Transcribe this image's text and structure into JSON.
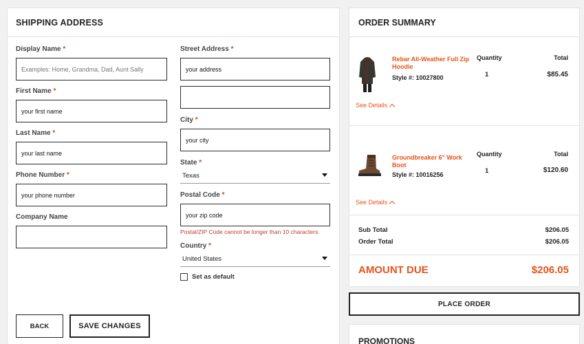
{
  "shipping": {
    "title": "SHIPPING ADDRESS",
    "required_mark": "*",
    "display_name": {
      "label": "Display Name",
      "value": "",
      "placeholder": "Examples: Home, Grandma, Dad, Aunt Sally"
    },
    "first_name": {
      "label": "First Name",
      "value": "your first name"
    },
    "last_name": {
      "label": "Last Name",
      "value": "your last name"
    },
    "phone": {
      "label": "Phone Number",
      "value": "your phone number"
    },
    "company": {
      "label": "Company Name",
      "value": ""
    },
    "street": {
      "label": "Street Address",
      "value": "your address"
    },
    "street2": {
      "value": ""
    },
    "city": {
      "label": "City",
      "value": "your city"
    },
    "state": {
      "label": "State",
      "value": "Texas"
    },
    "postal": {
      "label": "Postal Code",
      "value": "your zip code",
      "error": "Postal/ZIP Code cannot be longer than 10 characters."
    },
    "country": {
      "label": "Country",
      "value": "United States"
    },
    "default_label": "Set as default",
    "back_label": "BACK",
    "save_label": "SAVE CHANGES"
  },
  "summary": {
    "title": "ORDER SUMMARY",
    "quantity_label": "Quantity",
    "total_label": "Total",
    "see_details": "See Details",
    "items": [
      {
        "name": "Rebar All-Weather Full Zip Hoodie",
        "style": "Style #: 10027800",
        "quantity": "1",
        "total": "$85.45",
        "icon": "hoodie-icon"
      },
      {
        "name": "Groundbreaker 6\" Work Boot",
        "style": "Style #: 10016256",
        "quantity": "1",
        "total": "$120.60",
        "icon": "boot-icon"
      }
    ],
    "sub_total_label": "Sub Total",
    "sub_total": "$206.05",
    "order_total_label": "Order Total",
    "order_total": "$206.05",
    "amount_due_label": "AMOUNT DUE",
    "amount_due": "$206.05"
  },
  "place_order_label": "PLACE ORDER",
  "promotions_title": "PROMOTIONS",
  "colors": {
    "accent": "#e5541b",
    "error": "#c0392b",
    "border": "#222222",
    "background": "#f1f1f1"
  }
}
